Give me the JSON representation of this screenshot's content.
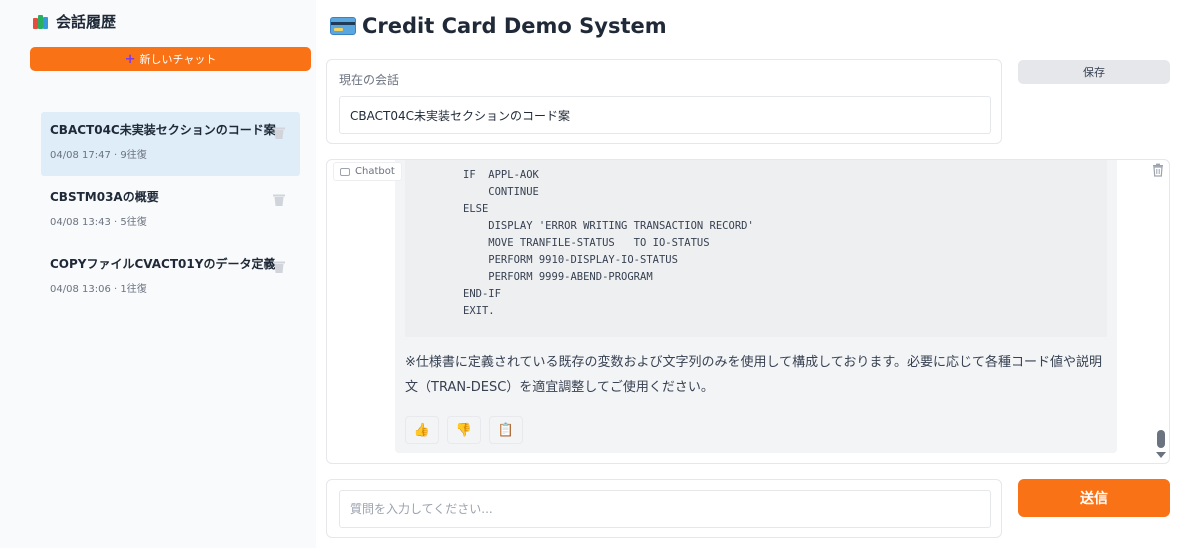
{
  "sidebar": {
    "title": "会話履歴",
    "new_chat_label": "新しいチャット",
    "conversations": [
      {
        "title": "CBACT04C未実装セクションのコード案",
        "meta": "04/08 17:47 · 9往復",
        "active": true
      },
      {
        "title": "CBSTM03Aの概要",
        "meta": "04/08 13:43 · 5往復",
        "active": false
      },
      {
        "title": "COPYファイルCVACT01Yのデータ定義",
        "meta": "04/08 13:06 · 1往復",
        "active": false
      }
    ]
  },
  "header": {
    "title": "Credit Card Demo System",
    "icon": "credit-card-icon"
  },
  "current": {
    "label": "現在の会話",
    "value": "CBACT04C未実装セクションのコード案"
  },
  "save_label": "保存",
  "chat": {
    "label": "Chatbot",
    "code": "IF  APPL-AOK\n    CONTINUE\nELSE\n    DISPLAY 'ERROR WRITING TRANSACTION RECORD'\n    MOVE TRANFILE-STATUS   TO IO-STATUS\n    PERFORM 9910-DISPLAY-IO-STATUS\n    PERFORM 9999-ABEND-PROGRAM\nEND-IF\nEXIT.",
    "note": "※仕様書に定義されている既存の変数および文字列のみを使用して構成しております。必要に応じて各種コード値や説明文（TRAN-DESC）を適宜調整してご使用ください。",
    "actions": {
      "like": "👍",
      "dislike": "👎",
      "copy": "📋"
    }
  },
  "input": {
    "placeholder": "質問を入力してください..."
  },
  "send_label": "送信",
  "colors": {
    "accent": "#f97316",
    "active_item": "#deedf8"
  }
}
